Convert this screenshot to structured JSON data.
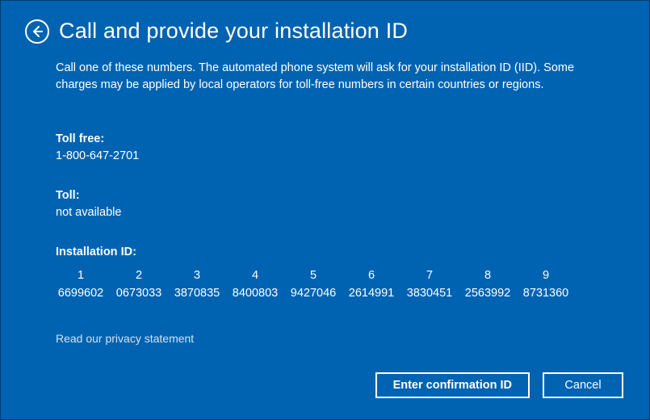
{
  "header": {
    "title": "Call and provide your installation ID"
  },
  "intro": "Call one of these numbers. The automated phone system will ask for your installation ID (IID). Some charges may be applied by local operators for toll-free numbers in certain countries or regions.",
  "toll_free": {
    "label": "Toll free:",
    "value": "1-800-647-2701"
  },
  "toll": {
    "label": "Toll:",
    "value": "not available"
  },
  "installation_id": {
    "label": "Installation ID:",
    "groups": [
      {
        "index": "1",
        "value": "6699602"
      },
      {
        "index": "2",
        "value": "0673033"
      },
      {
        "index": "3",
        "value": "3870835"
      },
      {
        "index": "4",
        "value": "8400803"
      },
      {
        "index": "5",
        "value": "9427046"
      },
      {
        "index": "6",
        "value": "2614991"
      },
      {
        "index": "7",
        "value": "3830451"
      },
      {
        "index": "8",
        "value": "2563992"
      },
      {
        "index": "9",
        "value": "8731360"
      }
    ]
  },
  "privacy_link": "Read our privacy statement",
  "buttons": {
    "enter_confirmation": "Enter confirmation ID",
    "cancel": "Cancel"
  }
}
